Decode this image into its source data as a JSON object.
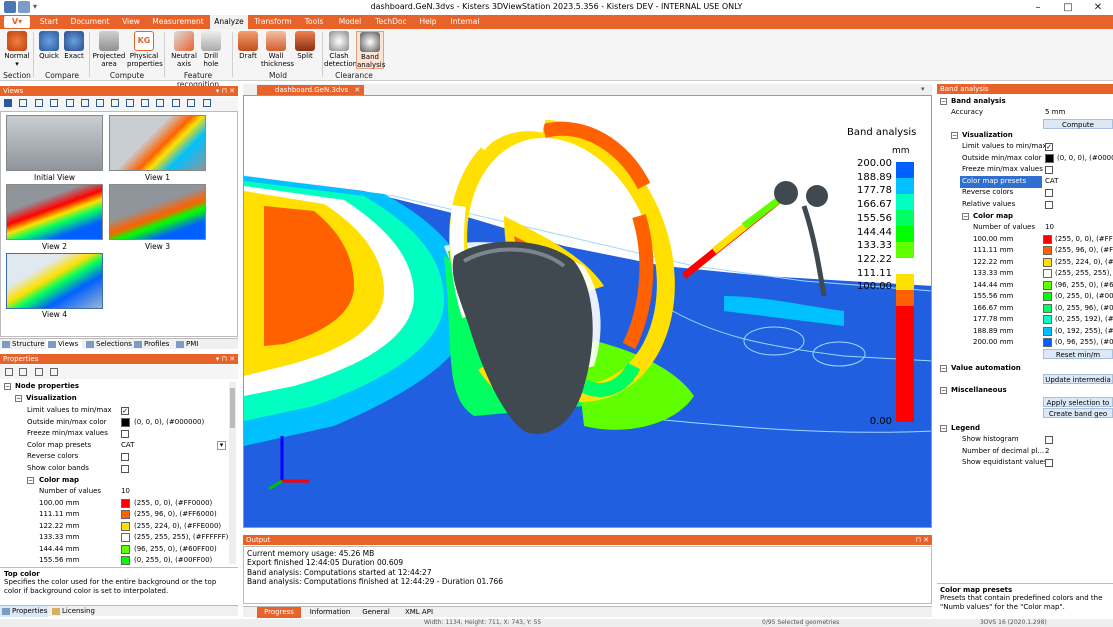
{
  "window": {
    "title": "dashboard.GeN.3dvs - Kisters 3DViewStation 2023.5.356 - Kisters DEV - INTERNAL USE ONLY"
  },
  "menu": {
    "logo": "V",
    "items": [
      "Start",
      "Document",
      "View",
      "Measurement",
      "Analyze",
      "Transform",
      "Tools",
      "Model",
      "TechDoc",
      "Help",
      "Internal"
    ],
    "active": "Analyze"
  },
  "ribbon": {
    "buttons": [
      {
        "label": "Normal",
        "sub": "▾",
        "icon": "section-icon"
      },
      {
        "label": "Quick",
        "icon": "quick-compare-icon"
      },
      {
        "label": "Exact",
        "icon": "exact-compare-icon"
      },
      {
        "label": "Projected area",
        "icon": "projected-area-icon"
      },
      {
        "label": "Physical properties",
        "icon": "physical-properties-icon"
      },
      {
        "label": "Neutral axis",
        "icon": "neutral-axis-icon"
      },
      {
        "label": "Drill hole",
        "icon": "drill-hole-icon"
      },
      {
        "label": "Draft",
        "icon": "draft-icon"
      },
      {
        "label": "Wall thickness",
        "icon": "wall-thickness-icon"
      },
      {
        "label": "Split",
        "icon": "split-icon"
      },
      {
        "label": "Clash detection",
        "icon": "clash-detection-icon"
      },
      {
        "label": "Band analysis",
        "icon": "band-analysis-icon"
      }
    ],
    "groups": [
      "Section",
      "Compare",
      "Compute",
      "Feature recognition",
      "Mold",
      "Clearance"
    ]
  },
  "views_panel": {
    "title": "Views",
    "thumbnails": [
      "Initial View",
      "View 1",
      "View 2",
      "View 3",
      "View 4"
    ],
    "tabs": [
      "Structure",
      "Views",
      "Selections",
      "Profiles",
      "PMI"
    ],
    "active_tab": "Views"
  },
  "properties_panel": {
    "title": "Properties",
    "rows": [
      {
        "label": "Node properties",
        "kind": "group"
      },
      {
        "label": "Visualization",
        "kind": "subgroup"
      },
      {
        "label": "Limit values to min/max",
        "kind": "check",
        "checked": true
      },
      {
        "label": "Outside min/max color",
        "kind": "color",
        "value": "(0, 0, 0), (#000000)",
        "color": "#000000"
      },
      {
        "label": "Freeze min/max values",
        "kind": "check",
        "checked": false
      },
      {
        "label": "Color map presets",
        "kind": "select",
        "value": "CAT"
      },
      {
        "label": "Reverse colors",
        "kind": "check",
        "checked": false
      },
      {
        "label": "Show color bands",
        "kind": "check",
        "checked": false
      },
      {
        "label": "Color map",
        "kind": "subgroup2"
      },
      {
        "label": "Number of values",
        "kind": "value",
        "value": "10"
      },
      {
        "label": "100.00 mm",
        "kind": "color",
        "value": "(255, 0, 0), (#FF0000)",
        "color": "#ff0000"
      },
      {
        "label": "111.11 mm",
        "kind": "color",
        "value": "(255, 96, 0), (#FF6000)",
        "color": "#ff6000"
      },
      {
        "label": "122.22 mm",
        "kind": "color",
        "value": "(255, 224, 0), (#FFE000)",
        "color": "#ffe000"
      },
      {
        "label": "133.33 mm",
        "kind": "color",
        "value": "(255, 255, 255), (#FFFFFF)",
        "color": "#ffffff"
      },
      {
        "label": "144.44 mm",
        "kind": "color",
        "value": "(96, 255, 0), (#60FF00)",
        "color": "#60ff00"
      },
      {
        "label": "155.56 mm",
        "kind": "color",
        "value": "(0, 255, 0), (#00FF00)",
        "color": "#00ff00"
      }
    ],
    "help_title": "Top color",
    "help_text": "Specifies the color used for the entire background or the top color if background color is set to interpolated.",
    "tabs": [
      "Properties",
      "Licensing"
    ]
  },
  "document_tab": {
    "label": "dashboard.GeN.3dvs"
  },
  "legend": {
    "title": "Band analysis",
    "unit": "mm",
    "values": [
      "200.00",
      "188.89",
      "177.78",
      "166.67",
      "155.56",
      "144.44",
      "133.33",
      "122.22",
      "111.11",
      "100.00"
    ],
    "bottom": "0.00",
    "colors": [
      "#0060ff",
      "#00c0ff",
      "#00ffc0",
      "#00ff60",
      "#00ff00",
      "#60ff00",
      "#ffffff",
      "#ffe000",
      "#ff6000",
      "#ff0000"
    ]
  },
  "output_panel": {
    "title": "Output",
    "lines": [
      "Current memory usage: 45.26 MB",
      "Export finished 12:44:05 Duration 00.609",
      "Band analysis: Computations started at 12:44:27",
      "Band analysis: Computations finished at 12:44:29 - Duration 01.766"
    ],
    "tabs": [
      "Progress",
      "Information",
      "General",
      "XML API"
    ],
    "active_tab": "Progress"
  },
  "band_panel": {
    "title": "Band analysis",
    "section": "Band analysis",
    "accuracy_label": "Accuracy",
    "accuracy_value": "5 mm",
    "compute_label": "Compute",
    "visualization": "Visualization",
    "rows": [
      {
        "label": "Limit values to min/max",
        "kind": "check",
        "checked": true
      },
      {
        "label": "Outside min/max color",
        "kind": "color",
        "value": "(0, 0, 0), (#000000",
        "color": "#000000"
      },
      {
        "label": "Freeze min/max values",
        "kind": "check",
        "checked": false
      },
      {
        "label": "Color map presets",
        "kind": "value",
        "value": "CAT",
        "selected": true
      },
      {
        "label": "Reverse colors",
        "kind": "check",
        "checked": false
      },
      {
        "label": "Relative values",
        "kind": "check",
        "checked": false
      }
    ],
    "color_map": "Color map",
    "number_of_values_label": "Number of values",
    "number_of_values": "10",
    "color_rows": [
      {
        "label": "100.00 mm",
        "value": "(255, 0, 0), (#FF00",
        "color": "#ff0000"
      },
      {
        "label": "111.11 mm",
        "value": "(255, 96, 0), (#FF6",
        "color": "#ff6000"
      },
      {
        "label": "122.22 mm",
        "value": "(255, 224, 0), (#FF",
        "color": "#ffe000"
      },
      {
        "label": "133.33 mm",
        "value": "(255, 255, 255), (#F",
        "color": "#ffffff"
      },
      {
        "label": "144.44 mm",
        "value": "(96, 255, 0), (#60F",
        "color": "#60ff00"
      },
      {
        "label": "155.56 mm",
        "value": "(0, 255, 0), (#00F",
        "color": "#00ff00"
      },
      {
        "label": "166.67 mm",
        "value": "(0, 255, 96), (#00",
        "color": "#00ff60"
      },
      {
        "label": "177.78 mm",
        "value": "(0, 255, 192), (#00",
        "color": "#00ffc0"
      },
      {
        "label": "188.89 mm",
        "value": "(0, 192, 255), (#00",
        "color": "#00c0ff"
      },
      {
        "label": "200.00 mm",
        "value": "(0, 96, 255), (#006",
        "color": "#0060ff"
      }
    ],
    "reset_label": "Reset min/m",
    "value_automation": "Value automation",
    "update_label": "Update intermedia",
    "miscellaneous": "Miscellaneous",
    "apply_label": "Apply selection to",
    "create_label": "Create band geo",
    "legend_group": "Legend",
    "legend_rows": [
      {
        "label": "Show histogram",
        "kind": "check",
        "checked": false
      },
      {
        "label": "Number of decimal pl...",
        "kind": "value",
        "value": "2"
      },
      {
        "label": "Show equidistant values",
        "kind": "check",
        "checked": false
      }
    ],
    "help_title": "Color map presets",
    "help_text": "Presets that contain predefined colors and the \"Numb values\" for the \"Color map\"."
  },
  "status": {
    "dims": "Width: 1134, Height: 711, X: 743, Y: 55",
    "selection": "0/95 Selected geometries",
    "version": "3DVS 16 (2020.1.298)"
  }
}
